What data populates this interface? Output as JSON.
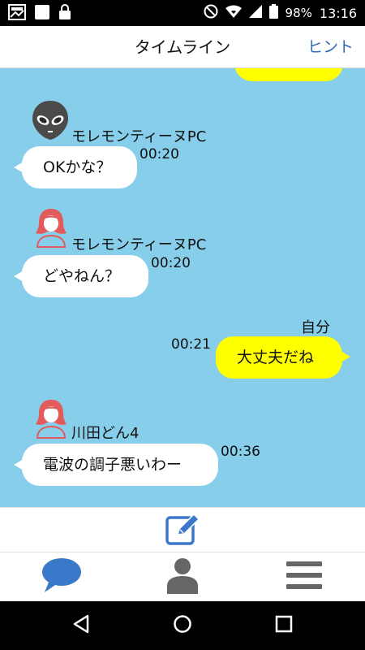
{
  "status_bar": {
    "battery": "98%",
    "time": "13:16",
    "icons": [
      "gallery-icon",
      "square-icon",
      "lock-icon",
      "no-disturb-icon",
      "wifi-icon",
      "signal-icon",
      "battery-icon"
    ]
  },
  "header": {
    "title": "タイムライン",
    "hint_label": "ヒント"
  },
  "messages": [
    {
      "side": "right",
      "text": "",
      "partial": true
    },
    {
      "side": "left",
      "sender": "モレモンティーヌPC",
      "avatar": "alien-icon",
      "text": "OKかな？",
      "time": "00:20"
    },
    {
      "side": "left",
      "sender": "モレモンティーヌPC",
      "avatar": "woman-icon",
      "text": "どやねん？",
      "time": "00:20"
    },
    {
      "side": "right",
      "sender": "自分",
      "text": "大丈夫だね",
      "time": "00:21"
    },
    {
      "side": "left",
      "sender": "川田どん4",
      "avatar": "woman-icon",
      "text": "電波の調子悪いわー",
      "time": "00:36"
    }
  ],
  "compose": {
    "icon": "compose-icon"
  },
  "bottom_nav": {
    "items": [
      {
        "icon": "chat-bubble-icon",
        "active": true
      },
      {
        "icon": "person-icon",
        "active": false
      },
      {
        "icon": "menu-icon",
        "active": false
      }
    ]
  },
  "android_nav": [
    "back-icon",
    "home-icon",
    "recents-icon"
  ],
  "colors": {
    "timeline_bg": "#87ceeb",
    "own_bubble": "#ffff00",
    "other_bubble": "#ffffff",
    "accent": "#3a78c9",
    "hint": "#2f6cb5",
    "avatar_red": "#e25b5b",
    "nav_gray": "#666666"
  }
}
